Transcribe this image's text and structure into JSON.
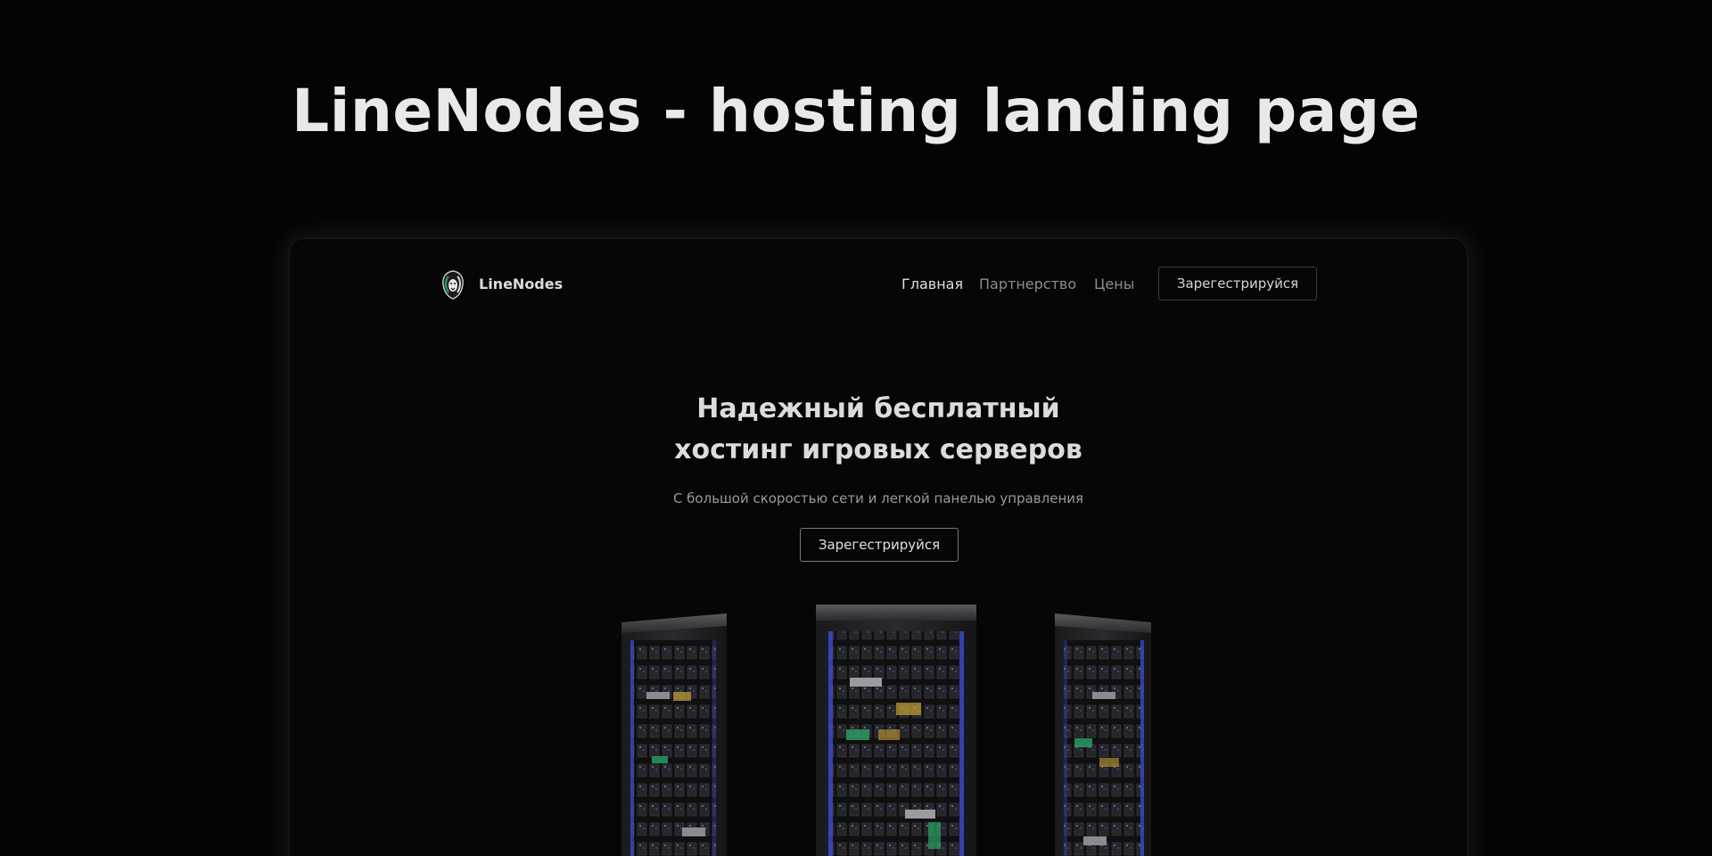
{
  "showcase": {
    "title": "LineNodes - hosting landing page"
  },
  "nav": {
    "brand": "LineNodes",
    "links": [
      "Главная",
      "Партнерство",
      "Цены"
    ],
    "cta_label": "Зарегестрируйся"
  },
  "hero": {
    "title_line1": "Надежный бесплатный",
    "title_line2": "хостинг игровых серверов",
    "subtitle": "С большой скоростью сети и легкой панелью управления",
    "cta_label": "Зарегестрируйся"
  },
  "colors": {
    "background": "#040404",
    "frame_bg": "#060606",
    "accent_blue": "#3b4bd6",
    "logo_green": "#2f8f5a"
  },
  "icons": {
    "logo": "lion-logo-icon"
  }
}
